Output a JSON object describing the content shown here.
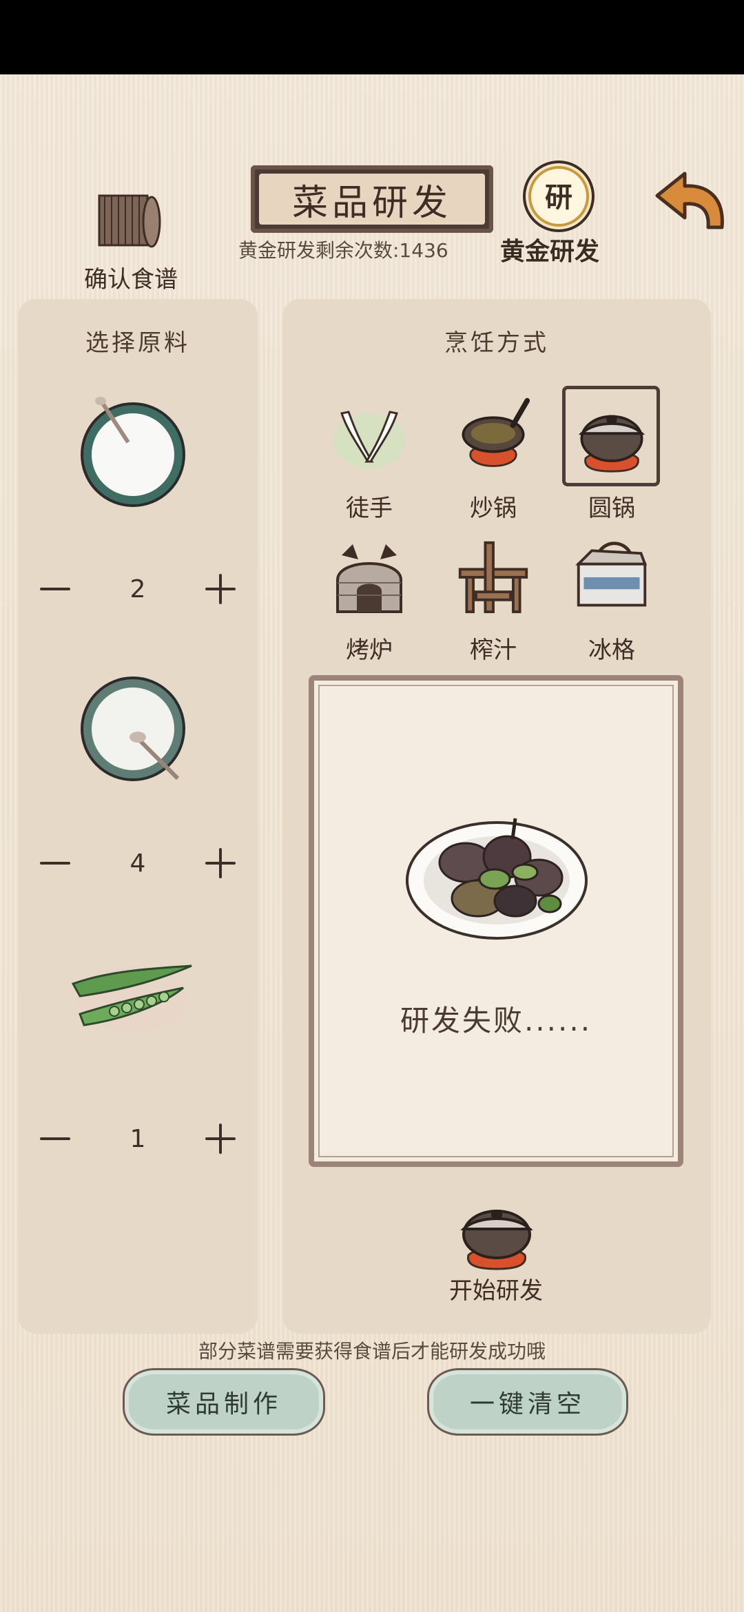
{
  "header": {
    "title": "菜品研发",
    "confirm_recipe_label": "确认食谱",
    "gold_count_text": "黄金研发剩余次数:1436",
    "gold_label": "黄金研发"
  },
  "left_panel": {
    "title": "选择原料",
    "ingredients": [
      {
        "icon": "rice-bowl-icon",
        "quantity": "2"
      },
      {
        "icon": "flour-bowl-icon",
        "quantity": "4"
      },
      {
        "icon": "pea-pods-icon",
        "quantity": "1"
      }
    ]
  },
  "right_panel": {
    "title": "烹饪方式",
    "methods": [
      {
        "label": "徒手",
        "icon": "bare-hands-icon",
        "selected": false
      },
      {
        "label": "炒锅",
        "icon": "wok-icon",
        "selected": false
      },
      {
        "label": "圆锅",
        "icon": "round-pot-icon",
        "selected": true
      },
      {
        "label": "烤炉",
        "icon": "oven-icon",
        "selected": false
      },
      {
        "label": "榨汁",
        "icon": "juicer-icon",
        "selected": false
      },
      {
        "label": "冰格",
        "icon": "ice-box-icon",
        "selected": false
      }
    ],
    "result_text": "研发失败......",
    "start_label": "开始研发"
  },
  "footer": {
    "hint": "部分菜谱需要获得食谱后才能研发成功哦",
    "make_label": "菜品制作",
    "clear_label": "一键清空"
  },
  "colors": {
    "paper": "#f1e6d6",
    "panel": "#e7d9c7",
    "banner": "#4c3b34",
    "button_green": "#bfd2c7",
    "ink": "#3e2d25"
  }
}
